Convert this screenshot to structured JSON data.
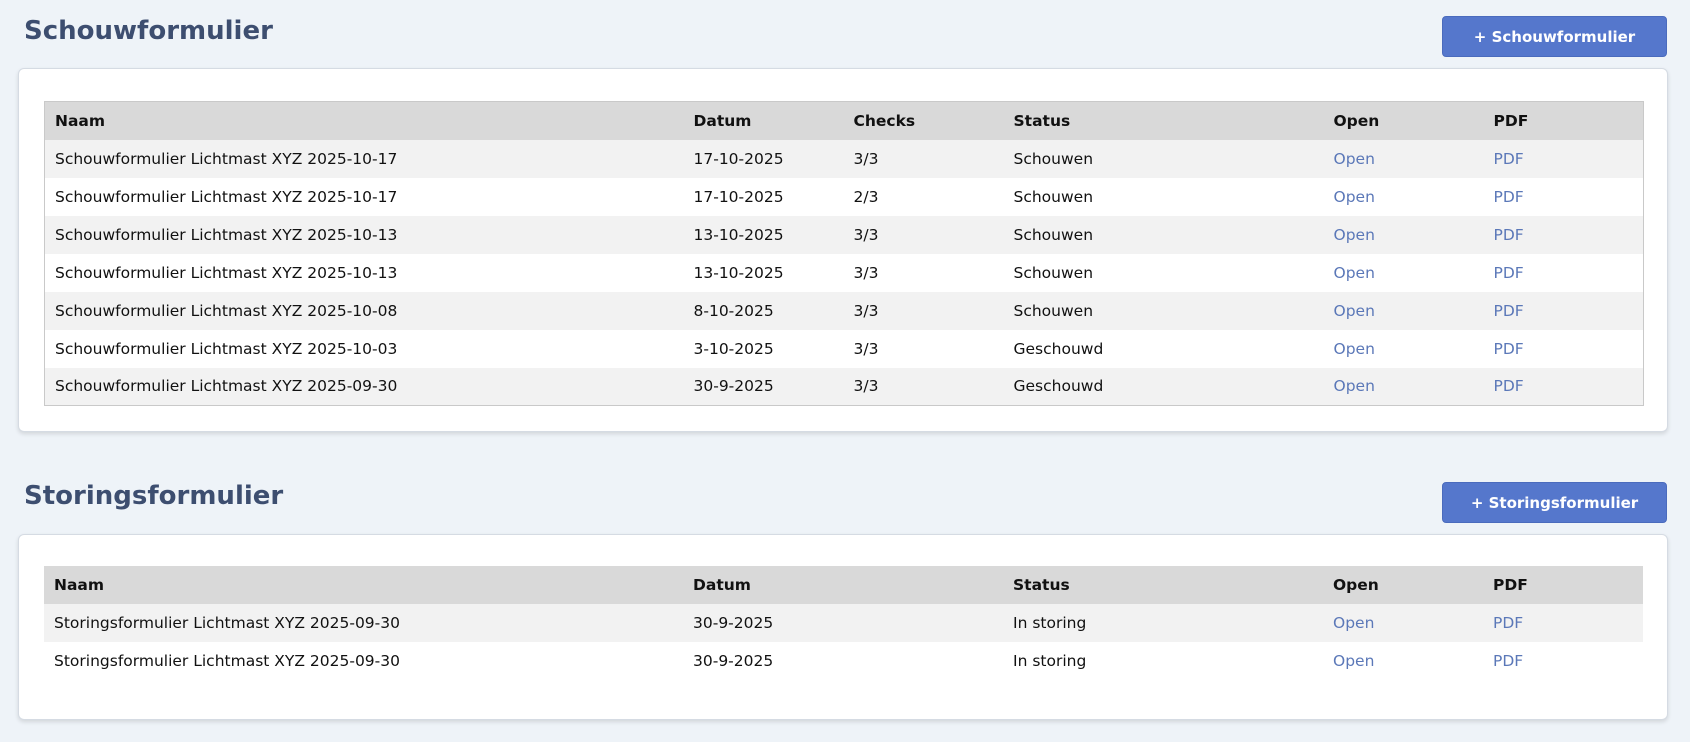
{
  "schouw": {
    "title": "Schouwformulier",
    "add_button": "+ Schouwformulier",
    "headers": [
      "Naam",
      "Datum",
      "Checks",
      "Status",
      "Open",
      "PDF"
    ],
    "rows": [
      [
        "Schouwformulier Lichtmast XYZ 2025-10-17",
        "17-10-2025",
        "3/3",
        "Schouwen",
        "Open",
        "PDF"
      ],
      [
        "Schouwformulier Lichtmast XYZ 2025-10-17",
        "17-10-2025",
        "2/3",
        "Schouwen",
        "Open",
        "PDF"
      ],
      [
        "Schouwformulier Lichtmast XYZ 2025-10-13",
        "13-10-2025",
        "3/3",
        "Schouwen",
        "Open",
        "PDF"
      ],
      [
        "Schouwformulier Lichtmast XYZ 2025-10-13",
        "13-10-2025",
        "3/3",
        "Schouwen",
        "Open",
        "PDF"
      ],
      [
        "Schouwformulier Lichtmast XYZ 2025-10-08",
        "8-10-2025",
        "3/3",
        "Schouwen",
        "Open",
        "PDF"
      ],
      [
        "Schouwformulier Lichtmast XYZ 2025-10-03",
        "3-10-2025",
        "3/3",
        "Geschouwd",
        "Open",
        "PDF"
      ],
      [
        "Schouwformulier Lichtmast XYZ 2025-09-30",
        "30-9-2025",
        "3/3",
        "Geschouwd",
        "Open",
        "PDF"
      ]
    ]
  },
  "storing": {
    "title": "Storingsformulier",
    "add_button": "+ Storingsformulier",
    "headers": [
      "Naam",
      "Datum",
      "Status",
      "Open",
      "PDF"
    ],
    "rows": [
      [
        "Storingsformulier Lichtmast XYZ 2025-09-30",
        "30-9-2025",
        "In storing",
        "Open",
        "PDF"
      ],
      [
        "Storingsformulier Lichtmast XYZ 2025-09-30",
        "30-9-2025",
        "In storing",
        "Open",
        "PDF"
      ]
    ]
  },
  "colors": {
    "page_bg": "#eef3f8",
    "title": "#3d4e70",
    "button": "#5577cc",
    "link": "#5b78b8"
  }
}
